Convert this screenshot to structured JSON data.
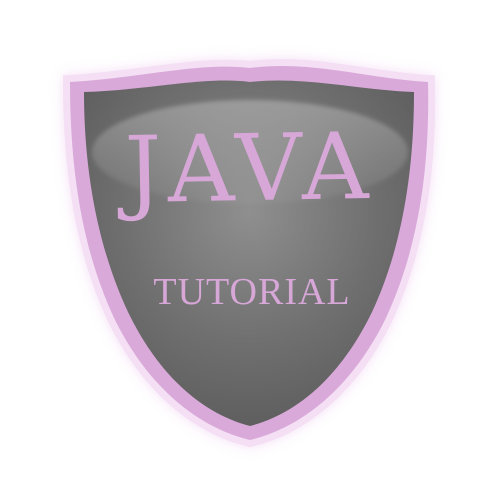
{
  "badge": {
    "title": "JAVA",
    "subtitle": "TUTORIAL",
    "shape": "shield-icon"
  },
  "colors": {
    "background": "#ffffff",
    "shield_fill_top": "#8f8f8f",
    "shield_fill_mid": "#6f6f6f",
    "shield_fill_bottom": "#5f5f5f",
    "border": "#d8a8d8",
    "glow": "#e8bde8",
    "text": "#d7a7d8"
  }
}
